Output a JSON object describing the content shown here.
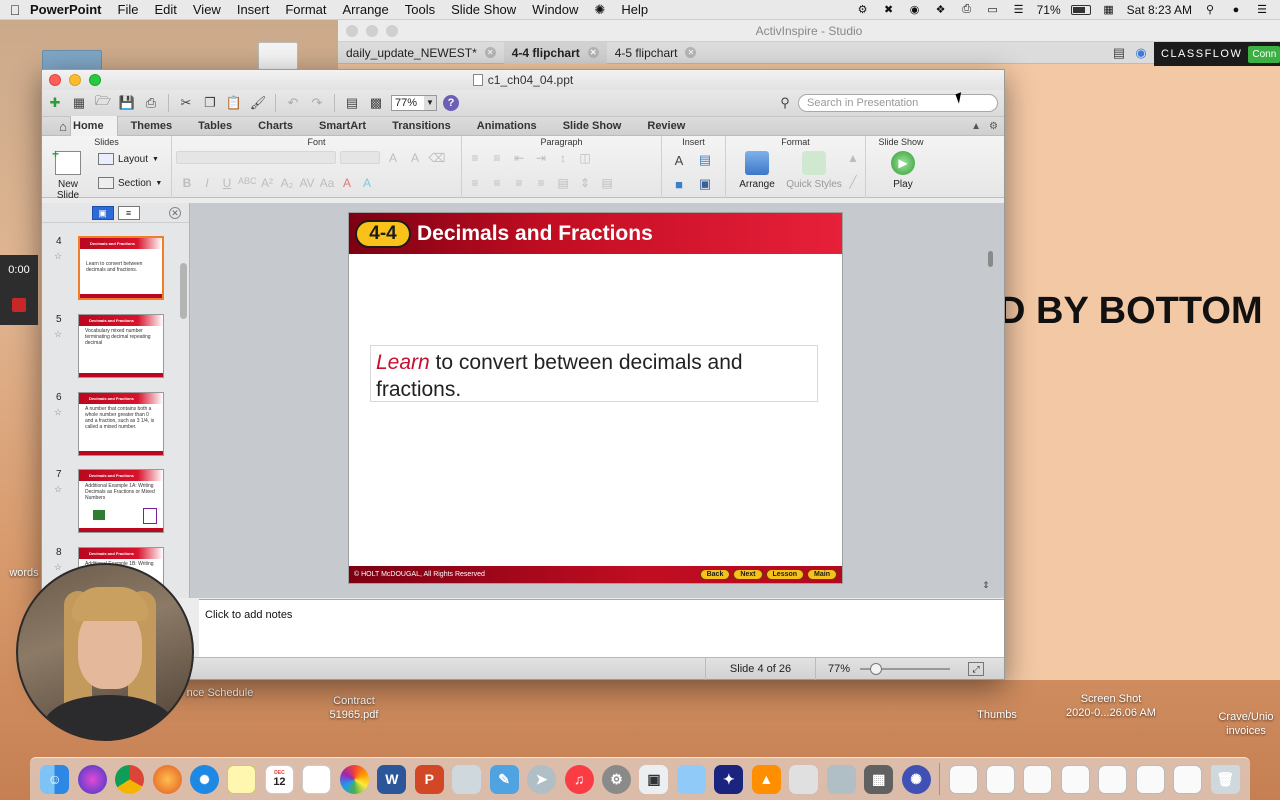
{
  "menubar": {
    "app_name": "PowerPoint",
    "items": [
      "File",
      "Edit",
      "View",
      "Insert",
      "Format",
      "Arrange",
      "Tools",
      "Slide Show",
      "Window",
      "Help"
    ],
    "battery": "71%",
    "clock": "Sat 8:23 AM"
  },
  "activinspire": {
    "title": "ActivInspire - Studio",
    "tabs": [
      "daily_update_NEWEST*",
      "4-4 flipchart",
      "4-5 flipchart"
    ],
    "classflow_label": "CLASSFLOW",
    "classflow_button": "Conn",
    "canvas_text": "D BY BOTTOM"
  },
  "ppt": {
    "title": "c1_ch04_04.ppt",
    "zoom": "77%",
    "search_placeholder": "Search in Presentation",
    "ribbon_tabs": [
      "Home",
      "Themes",
      "Tables",
      "Charts",
      "SmartArt",
      "Transitions",
      "Animations",
      "Slide Show",
      "Review"
    ],
    "groups": {
      "slides": "Slides",
      "font": "Font",
      "paragraph": "Paragraph",
      "insert": "Insert",
      "format": "Format",
      "slideshow": "Slide Show"
    },
    "buttons": {
      "new_slide": "New Slide",
      "layout": "Layout",
      "section": "Section",
      "arrange": "Arrange",
      "quick_styles": "Quick Styles",
      "play": "Play"
    },
    "thumbnails": [
      {
        "num": "4",
        "head": "Decimals and Fractions",
        "text": "Learn to convert between decimals and fractions."
      },
      {
        "num": "5",
        "head": "Decimals and Fractions",
        "text": "Vocabulary mixed number terminating decimal repeating decimal"
      },
      {
        "num": "6",
        "head": "Decimals and Fractions",
        "text": "A number that contains both a whole number greater than 0 and a fraction, such as 3 1/4, is called a mixed number."
      },
      {
        "num": "7",
        "head": "Decimals and Fractions",
        "text": "Additional Example 1A: Writing Decimals as Fractions or Mixed Numbers"
      },
      {
        "num": "8",
        "head": "Decimals and Fractions",
        "text": "Additional Example 1B: Writing Decimals as Fractions"
      }
    ],
    "slide": {
      "lesson": "4-4",
      "title": "Decimals and Fractions",
      "learn_word": "Learn",
      "body_rest": " to convert between decimals and fractions.",
      "copyright": "© HOLT McDOUGAL, All Rights Reserved",
      "nav": [
        "Back",
        "Next",
        "Lesson",
        "Main"
      ]
    },
    "notes_placeholder": "Click to add notes",
    "status": {
      "slide_of": "Slide 4 of 26",
      "zoom": "77%"
    }
  },
  "desktop": {
    "labels": [
      {
        "text": "Contract\n51965.pdf"
      },
      {
        "text": "Thumbs"
      },
      {
        "text": "Screen Shot\n2020-0...26.06 AM"
      },
      {
        "text": "Crave/Unio\ninvoices"
      },
      {
        "text": "nce Schedule"
      },
      {
        "text": "words"
      }
    ],
    "recording_time": "0:00"
  },
  "dock": {
    "calendar_month": "DEC",
    "calendar_day": "12"
  }
}
